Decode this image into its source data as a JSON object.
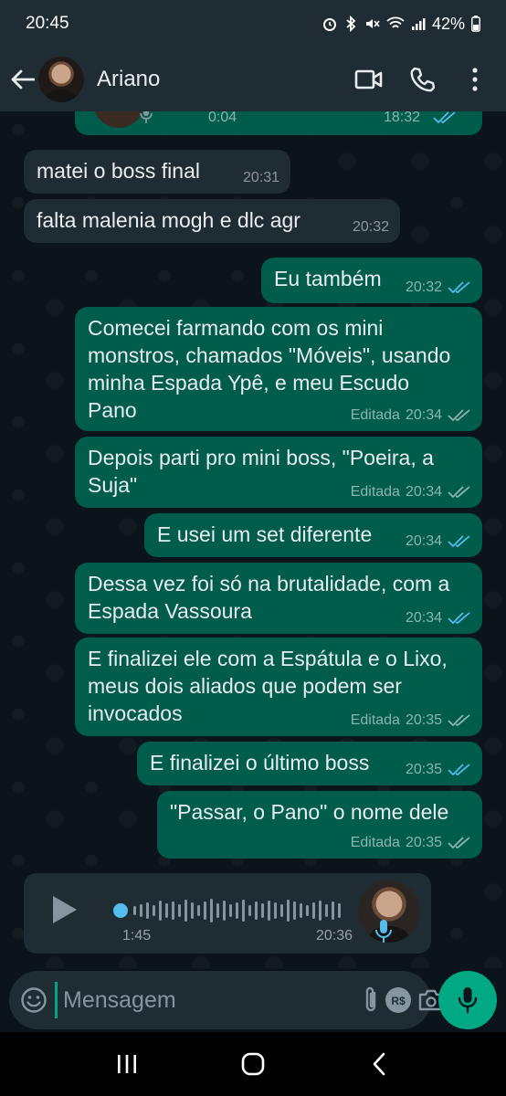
{
  "status": {
    "time": "20:45",
    "battery": "42%"
  },
  "header": {
    "contact_name": "Ariano",
    "icons": [
      "back-arrow-icon",
      "video-call-icon",
      "phone-icon",
      "more-icon"
    ]
  },
  "top_voice_message": {
    "duration": "0:04",
    "time": "18:32"
  },
  "messages": [
    {
      "dir": "in",
      "text": "matei o boss final",
      "time": "20:31",
      "edited": ""
    },
    {
      "dir": "in",
      "text": "falta malenia mogh e dlc agr",
      "time": "20:32",
      "edited": ""
    },
    {
      "dir": "out",
      "text": "Eu também",
      "time": "20:32",
      "edited": "",
      "read": true
    },
    {
      "dir": "out",
      "text": "Comecei farmando com os mini monstros, chamados \"Móveis\", usando minha Espada Ypê, e meu Escudo Pano",
      "time": "20:34",
      "edited": "Editada",
      "read": false
    },
    {
      "dir": "out",
      "text": "Depois parti pro mini boss, \"Poeira, a Suja\"",
      "time": "20:34",
      "edited": "Editada",
      "read": false
    },
    {
      "dir": "out",
      "text": "E usei um set diferente",
      "time": "20:34",
      "edited": "",
      "read": true
    },
    {
      "dir": "out",
      "text": "Dessa vez foi só na brutalidade, com a Espada Vassoura",
      "time": "20:34",
      "edited": "",
      "read": true
    },
    {
      "dir": "out",
      "text": "E finalizei ele com a Espátula e o Lixo, meus dois aliados que podem ser invocados",
      "time": "20:35",
      "edited": "Editada",
      "read": false
    },
    {
      "dir": "out",
      "text": "E finalizei o último boss",
      "time": "20:35",
      "edited": "",
      "read": true
    },
    {
      "dir": "out",
      "text": "\"Passar, o Pano\" o nome dele",
      "time": "20:35",
      "edited": "Editada",
      "read": false
    }
  ],
  "voice_message": {
    "duration": "1:45",
    "time": "20:36",
    "progress": 0.0
  },
  "composer": {
    "placeholder": "Mensagem",
    "icons": [
      "emoji-icon",
      "attach-icon",
      "payment-icon",
      "camera-icon",
      "mic-icon"
    ]
  },
  "colors": {
    "incoming": "#202c33",
    "outgoing": "#005c4b",
    "accent": "#00a884",
    "read_ticks": "#53bdeb"
  }
}
